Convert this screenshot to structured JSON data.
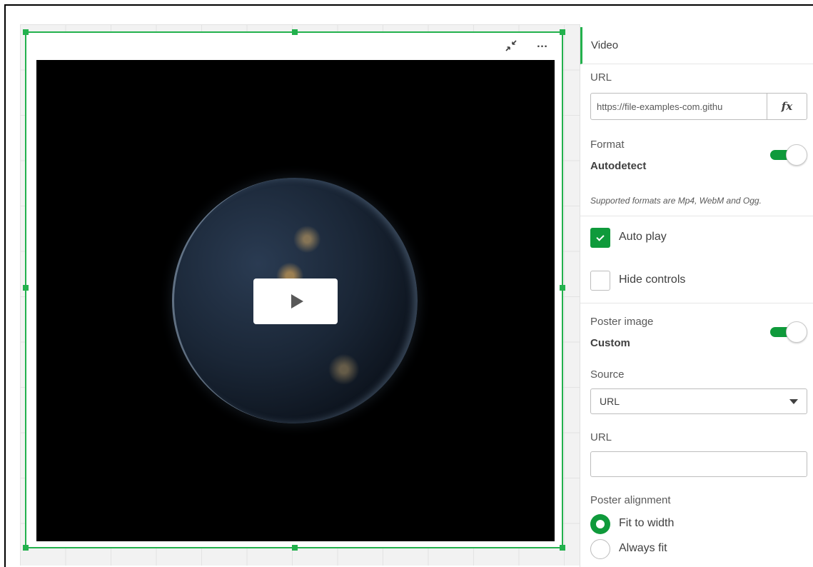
{
  "video_object": {
    "toolbar": {
      "exit_fullscreen_icon": "exit-fullscreen-icon",
      "more_label": "…"
    },
    "player": {
      "play_icon": "play-icon"
    }
  },
  "panel": {
    "header": "Video",
    "url_label": "URL",
    "url_value": "https://file-examples-com.githu",
    "fx_label": "fx",
    "format_label": "Format",
    "format_value": "Autodetect",
    "format_toggle_on": true,
    "supported_formats_hint": "Supported formats are Mp4, WebM and Ogg.",
    "auto_play_label": "Auto play",
    "auto_play_checked": true,
    "hide_controls_label": "Hide controls",
    "hide_controls_checked": false,
    "poster_image_label": "Poster image",
    "poster_image_value": "Custom",
    "poster_toggle_on": true,
    "source_label": "Source",
    "source_selected": "URL",
    "poster_url_label": "URL",
    "poster_url_value": "",
    "poster_alignment_label": "Poster alignment",
    "alignment_options": [
      {
        "label": "Fit to width",
        "selected": true
      },
      {
        "label": "Always fit",
        "selected": false
      }
    ]
  },
  "colors": {
    "accent_green": "#23b14d",
    "toggle_green": "#0f9a3b"
  }
}
